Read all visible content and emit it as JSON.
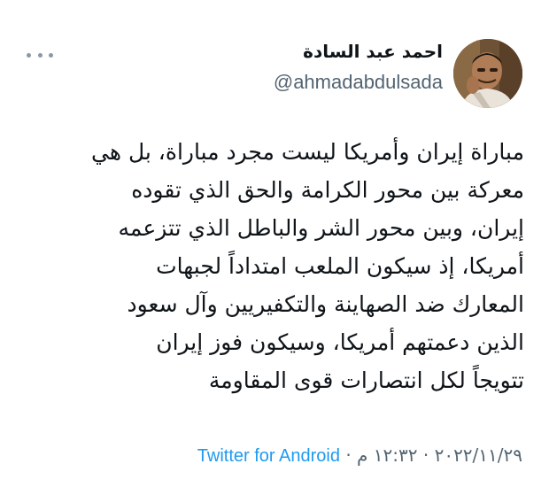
{
  "author": {
    "display_name": "احمد عبد السادة",
    "handle": "@ahmadabdulsada"
  },
  "tweet": {
    "lines": [
      "مباراة إيران وأمريكا ليست مجرد مباراة، بل هي",
      "معركة بين محور الكرامة والحق الذي تقوده",
      "إيران، وبين محور الشر والباطل الذي تتزعمه",
      "أمريكا، إذ سيكون الملعب امتداداً لجبهات",
      "المعارك ضد الصهاينة والتكفيريين وآل سعود",
      "الذين دعمتهم أمريكا، وسيكون فوز إيران",
      "تتويجاً لكل انتصارات قوى المقاومة"
    ]
  },
  "meta": {
    "date": "٢٠٢٢/١١/٢٩",
    "separator": "·",
    "time": "١٢:٣٢ م",
    "source": "Twitter for Android"
  },
  "icons": {
    "more": "more-horizontal-icon",
    "avatar": "profile-photo"
  },
  "colors": {
    "link": "#1d9bf0",
    "secondary_text": "#536471",
    "primary_text": "#0f1419"
  }
}
